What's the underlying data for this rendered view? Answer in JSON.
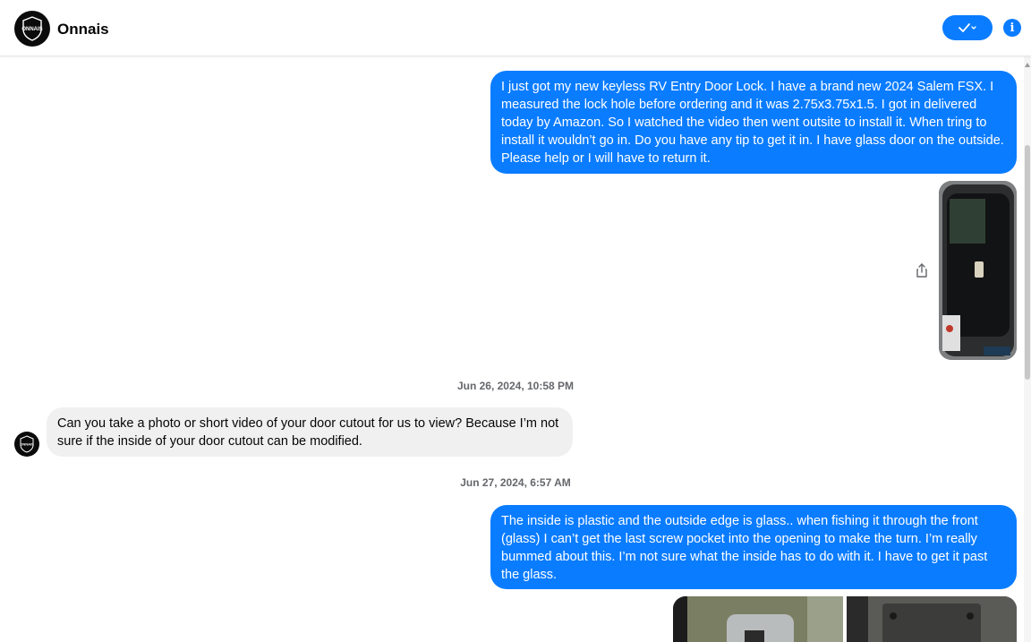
{
  "header": {
    "contact_name": "Onnais",
    "logo_text": "ONNAIS",
    "action_icon": "check-chevron-icon",
    "info_icon": "info-icon",
    "info_glyph": "i"
  },
  "messages": [
    {
      "direction": "outgoing",
      "text": "I just got my new keyless RV Entry Door Lock. I have a brand new 2024 Salem FSX. I measured the lock hole before ordering and it was 2.75x3.75x1.5.  I got in delivered today by Amazon. So I watched the video then went outsite to install it. When tring to install it wouldn’t go in.  Do you have any tip to get it in. I have glass door on the outside.  Please help or I will have to return it."
    },
    {
      "direction": "outgoing",
      "attachment": "photo",
      "description_icon": "share-icon"
    },
    {
      "timestamp": "Jun 26, 2024, 10:58 PM"
    },
    {
      "direction": "incoming",
      "text": "Can you take a photo or short video of your door cutout for us to view? Because I’m not sure if the inside of your door cutout can be modified."
    },
    {
      "timestamp": "Jun 27, 2024, 6:57 AM"
    },
    {
      "direction": "outgoing",
      "text": "The inside is plastic and the outside edge is glass.. when fishing it through the front (glass) I can’t get the last screw pocket into the opening to make the turn. I’m really bummed about this.  I’m not sure what the inside has to do with it. I have to get it past the glass."
    },
    {
      "direction": "outgoing",
      "attachment": "photos",
      "count": 2
    }
  ],
  "colors": {
    "accent": "#0a7cff",
    "incoming_bubble": "#f0f0f0",
    "timestamp": "#65676b"
  }
}
